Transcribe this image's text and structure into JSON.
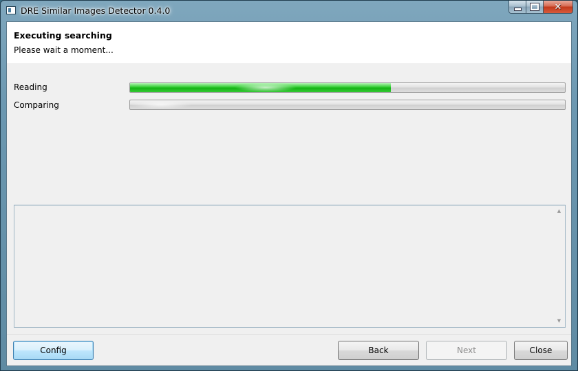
{
  "window": {
    "title": "DRE Similar Images Detector 0.4.0",
    "controls": {
      "minimize": "minimize",
      "maximize": "maximize",
      "close": "✕"
    }
  },
  "header": {
    "title": "Executing searching",
    "subtitle": "Please wait a moment..."
  },
  "progress": [
    {
      "label": "Reading",
      "percent": 60
    },
    {
      "label": "Comparing",
      "percent": 0
    }
  ],
  "log": {
    "text": ""
  },
  "buttons": {
    "config": "Config",
    "back": "Back",
    "next": "Next",
    "close": "Close"
  },
  "colors": {
    "progress_fill": "#2ec92e",
    "header_bg": "#ffffff",
    "client_bg": "#f0f0f0"
  },
  "icons": {
    "app": "app-window-icon",
    "scroll_up": "scroll-up-icon",
    "scroll_down": "scroll-down-icon"
  }
}
